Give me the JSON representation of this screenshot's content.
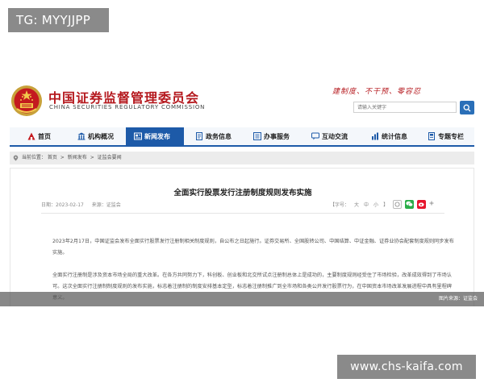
{
  "watermarks": {
    "tag": "TG: MYYJJPP",
    "site": "www.chs-kaifa.com"
  },
  "header": {
    "title": "中国证券监督管理委员会",
    "subtitle": "CHINA SECURITIES REGULATORY COMMISSION",
    "slogan": "建制度、不干预、零容忍",
    "search_placeholder": "请输入关键字"
  },
  "nav": {
    "items": [
      {
        "label": "首页",
        "icon": "home-icon"
      },
      {
        "label": "机构概况",
        "icon": "building-icon"
      },
      {
        "label": "新闻发布",
        "icon": "news-icon",
        "active": true
      },
      {
        "label": "政务信息",
        "icon": "document-icon"
      },
      {
        "label": "办事服务",
        "icon": "service-icon"
      },
      {
        "label": "互动交流",
        "icon": "chat-icon"
      },
      {
        "label": "统计信息",
        "icon": "stats-icon"
      },
      {
        "label": "专题专栏",
        "icon": "topic-icon"
      }
    ],
    "accent": "#1d5aa8",
    "brand": "#b5191e"
  },
  "breadcrumb": {
    "prefix": "当前位置：",
    "items": [
      "首页",
      "新闻发布",
      "证监会要闻"
    ],
    "separator": ">"
  },
  "article": {
    "title": "全面实行股票发行注册制度规则发布实施",
    "date": "日期：2023-02-17",
    "source": "来源：证监会",
    "font_label": "【字号：",
    "font_big": "大",
    "font_mid": "中",
    "font_small": "小",
    "font_close": "】",
    "paragraph1": "2023年2月17日，中国证监会发布全面实行股票发行注册制相关制度规则，自公布之日起施行。证券交易所、全国股转公司、中国结算、中证金融、证券业协会配套制度规则同步发布实施。",
    "paragraph2": "全面实行注册制是涉及资本市场全局的重大改革。在各方共同努力下，科创板、创业板和北交所试点注册制总体上是成功的，主要制度规则经受住了市场检验，改革成效得到了市场认可。这次全面实行注册制制度规则的发布实施，标志着注册制的制度安排基本定型，标志着注册制推广到全市场和各类公开发行股票行为，在中国资本市场改革发展进程中具有里程碑意义。"
  },
  "caption": "图片来源：证监会"
}
